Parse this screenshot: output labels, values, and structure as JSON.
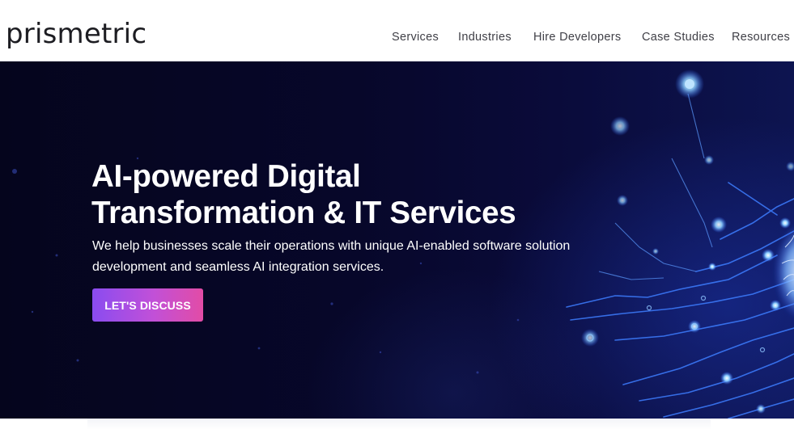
{
  "header": {
    "logo_text": "prismetric",
    "nav": [
      {
        "label": "Services"
      },
      {
        "label": "Industries"
      },
      {
        "label": "Hire Developers"
      },
      {
        "label": "Case Studies"
      },
      {
        "label": "Resources"
      }
    ]
  },
  "hero": {
    "title_line1": "AI-powered Digital",
    "title_line2": "Transformation & IT Services",
    "description_line1": "We help businesses scale their operations with unique AI-enabled software solution",
    "description_line2": "development and seamless AI integration services.",
    "cta_label": "LET'S DISCUSS"
  },
  "colors": {
    "hero_background": "#07072a",
    "circuit_glow": "#2f6bff",
    "cta_gradient_start": "#8a4cf0",
    "cta_gradient_end": "#e24ca6",
    "nav_text": "#3f3f46"
  }
}
